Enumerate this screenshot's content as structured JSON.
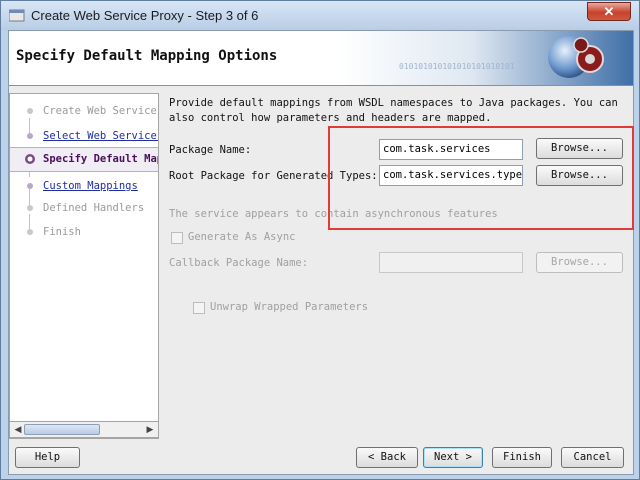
{
  "window": {
    "title": "Create Web Service Proxy - Step 3 of 6",
    "close_glyph": "✕"
  },
  "header": {
    "title": "Specify Default Mapping Options",
    "art_text": "010101010101010101010101"
  },
  "nav": {
    "items": [
      {
        "label": "Create Web Service Proxy",
        "state": "disabled"
      },
      {
        "label": "Select Web Service Description",
        "state": "link"
      },
      {
        "label": "Specify Default Mapping Options",
        "state": "current"
      },
      {
        "label": "Custom Mappings",
        "state": "link"
      },
      {
        "label": "Defined Handlers",
        "state": "disabled"
      },
      {
        "label": "Finish",
        "state": "disabled"
      }
    ],
    "scroll_left": "◀",
    "scroll_right": "▶"
  },
  "content": {
    "description": "Provide default mappings from WSDL namespaces to Java packages. You can also control how parameters and headers are mapped.",
    "package_name_label": "Package Name:",
    "package_name_value": "com.task.services",
    "root_package_label": "Root Package for Generated Types:",
    "root_package_value": "com.task.services.types",
    "browse_label": "Browse...",
    "async_note": "The service appears to contain asynchronous features",
    "generate_async_label": "Generate As Async",
    "callback_label": "Callback Package Name:",
    "callback_value": "",
    "unwrap_label": "Unwrap Wrapped Parameters"
  },
  "footer": {
    "help": "Help",
    "back": "< Back",
    "next": "Next >",
    "finish": "Finish",
    "cancel": "Cancel"
  },
  "colors": {
    "accent": "#4a0e5a",
    "link": "#1f2da3",
    "highlight": "#e03a3a"
  }
}
